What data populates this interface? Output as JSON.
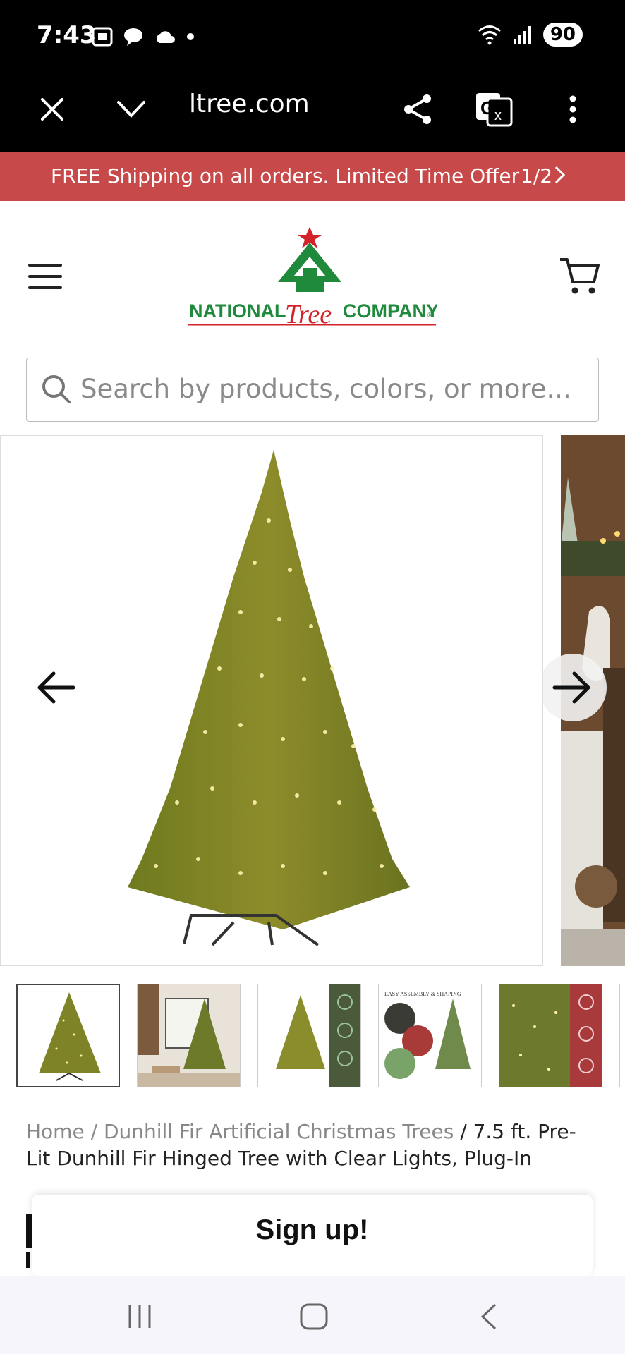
{
  "status_bar": {
    "time": "7:43",
    "battery": "90",
    "icons": [
      "screenshot-icon",
      "chat-bubble-icon",
      "cloud-icon",
      "dot-icon",
      "wifi-icon",
      "signal-icon"
    ]
  },
  "browser": {
    "url": "ltree.com",
    "icons": [
      "close-icon",
      "chevron-down-icon",
      "share-icon",
      "translate-icon",
      "more-vertical-icon"
    ]
  },
  "promo": {
    "text": "FREE Shipping on all orders. Limited Time Offer",
    "count": "1/2",
    "color": "#c8494a"
  },
  "header": {
    "logo_left": "NATIONAL",
    "logo_middle": "Tree",
    "logo_right": "COMPANY",
    "logo_registered": "®"
  },
  "search": {
    "placeholder": "Search by products, colors, or more..."
  },
  "gallery": {
    "thumbnail_count": 6,
    "thumb3_title": "EASY ASSEMBLY & SHAPING"
  },
  "breadcrumb": {
    "home": "Home",
    "sep1": "/",
    "category": "Dunhill Fir Artificial Christmas Trees",
    "sep2": "/",
    "current": "7.5 ft. Pre-Lit Dunhill Fir Hinged Tree with Clear Lights, Plug-In"
  },
  "signup": {
    "title": "Sign up!"
  },
  "colors": {
    "brand_green": "#1f8a3c",
    "brand_red": "#d3232a",
    "promo_bg": "#c8494a"
  }
}
